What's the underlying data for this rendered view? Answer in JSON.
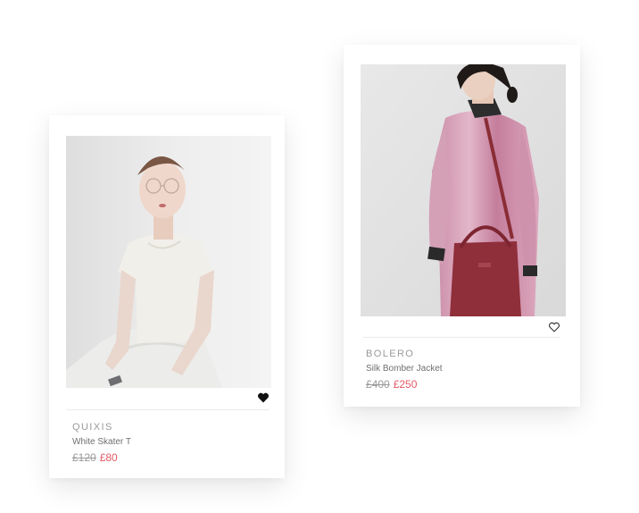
{
  "products": [
    {
      "brand": "QUIXIS",
      "name": "White Skater T",
      "old_price": "£120",
      "new_price": "£80",
      "photo_icon": "model-white-tee-photo",
      "favorite_icon": "heart-filled-icon",
      "favorited": true
    },
    {
      "brand": "BOLERO",
      "name": "Silk Bomber Jacket",
      "old_price": "£400",
      "new_price": "£250",
      "photo_icon": "model-pink-bomber-photo",
      "favorite_icon": "heart-outline-icon",
      "favorited": false
    }
  ],
  "colors": {
    "sale_price": "#e45a66",
    "old_price": "#9a9a9a",
    "brand": "#9a9a9a",
    "product_name": "#6f6f6f",
    "card_bg": "#ffffff"
  }
}
